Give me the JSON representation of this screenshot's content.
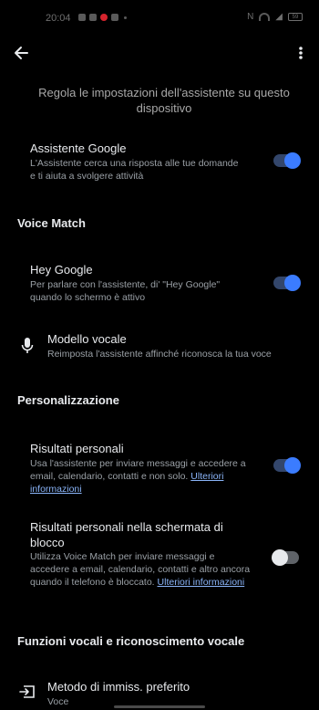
{
  "status_bar": {
    "time": "20:04",
    "battery": "59"
  },
  "icons": {
    "back": "arrow-back-icon",
    "more": "more-vert-icon",
    "mic": "mic-icon",
    "input_method": "input-method-icon"
  },
  "colors": {
    "background": "#000000",
    "toggle_on": "#3b7cff",
    "link": "#8ab4f8"
  },
  "intro": "Regola le impostazioni dell'assistente su questo dispositivo",
  "assistant": {
    "title": "Assistente Google",
    "description": "L'Assistente cerca una risposta alle tue domande e ti aiuta a svolgere attività",
    "enabled": true
  },
  "sections": {
    "voice_match": "Voice Match",
    "personalization": "Personalizzazione",
    "voice_functions": "Funzioni vocali e riconoscimento vocale"
  },
  "hey_google": {
    "title": "Hey Google",
    "description": "Per parlare con l'assistente, di' \"Hey Google\" quando lo schermo è attivo",
    "enabled": true
  },
  "voice_model": {
    "title": "Modello vocale",
    "description": "Reimposta l'assistente affinché riconosca la tua voce"
  },
  "personal_results": {
    "title": "Risultati personali",
    "description": "Usa l'assistente per inviare messaggi e accedere a email, calendario, contatti e non solo.",
    "link": "Ulteriori informazioni",
    "enabled": true
  },
  "lockscreen_results": {
    "title": "Risultati personali nella schermata di blocco",
    "description": "Utilizza Voice Match per inviare messaggi e accedere a email, calendario, contatti e altro ancora quando il telefono è bloccato.",
    "link": "Ulteriori informazioni",
    "enabled": false
  },
  "input_method": {
    "title": "Metodo di immiss. preferito",
    "value": "Voce"
  }
}
